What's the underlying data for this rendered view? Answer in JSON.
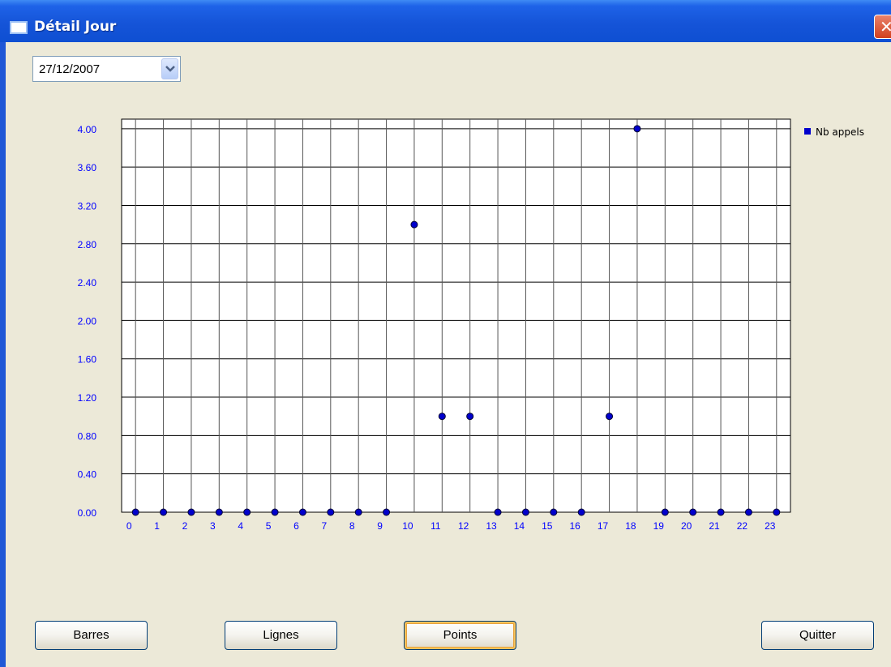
{
  "window": {
    "title": "Détail Jour",
    "close_icon": "close-icon"
  },
  "date_select": {
    "value": "27/12/2007"
  },
  "buttons": {
    "barres": "Barres",
    "lignes": "Lignes",
    "points": "Points",
    "quitter": "Quitter"
  },
  "chart_data": {
    "type": "scatter",
    "categories": [
      "0",
      "1",
      "2",
      "3",
      "4",
      "5",
      "6",
      "7",
      "8",
      "9",
      "10",
      "11",
      "12",
      "13",
      "14",
      "15",
      "16",
      "17",
      "18",
      "19",
      "20",
      "21",
      "22",
      "23"
    ],
    "series": [
      {
        "name": "Nb appels",
        "color": "#0000cc",
        "values": [
          0,
          0,
          0,
          0,
          0,
          0,
          0,
          0,
          0,
          0,
          3,
          1,
          1,
          0,
          0,
          0,
          0,
          1,
          4,
          0,
          0,
          0,
          0,
          0
        ]
      }
    ],
    "yticks": [
      "0.00",
      "0.40",
      "0.80",
      "1.20",
      "1.60",
      "2.00",
      "2.40",
      "2.80",
      "3.20",
      "3.60",
      "4.00"
    ],
    "ylim": [
      0,
      4.1
    ],
    "grid": true,
    "legend_position": "top-right",
    "colors": {
      "axis_labels": "#0000ff",
      "grid": "#000000"
    }
  }
}
